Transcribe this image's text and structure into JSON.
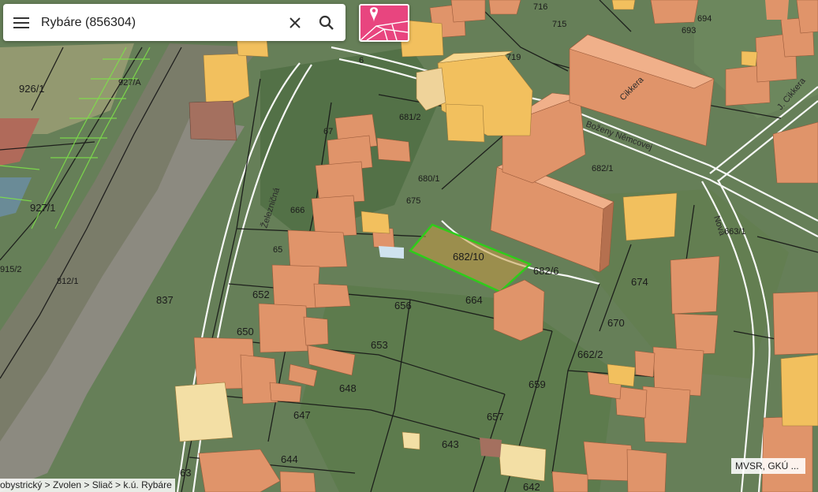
{
  "search": {
    "value": "Rybáre (856304)"
  },
  "icons": {
    "menu": "menu-icon",
    "clear": "close-icon",
    "search": "search-icon",
    "layers": "cadastre-layer-icon"
  },
  "breadcrumb": "obystrický > Zvolen > Sliač > k.ú. Rybáre",
  "attribution": "MVSR, GKÚ ...",
  "colors": {
    "selected_parcel": "#2ecc1a",
    "building": "#e0946a",
    "building_yellow": "#f2c05e",
    "layer_button": "#e8457f",
    "parcel_line": "#1a1a1a"
  },
  "parcels": {
    "p_926_1": "926/1",
    "p_927a": "927/A",
    "p_927_1": "927/1",
    "p_915_2": "915/2",
    "p_812_1": "812/1",
    "p_837": "837",
    "p_716": "716",
    "p_715": "715",
    "p_719": "719",
    "p_6": "6",
    "p_694": "694",
    "p_693": "693",
    "p_681_2": "681/2",
    "p_680_1": "680/1",
    "p_675": "675",
    "p_666": "666",
    "p_682_1": "682/1",
    "p_682_10": "682/10",
    "p_682_6": "682/6",
    "p_674": "674",
    "p_664": "664",
    "p_656": "656",
    "p_652": "652",
    "p_650": "650",
    "p_653": "653",
    "p_670": "670",
    "p_662_2": "662/2",
    "p_659": "659",
    "p_648": "648",
    "p_647": "647",
    "p_657": "657",
    "p_643": "643",
    "p_644": "644",
    "p_63": "63",
    "p_642": "642",
    "p_663_1": "663/1",
    "p_65": "65",
    "p_67": "67"
  },
  "streets": {
    "zeleznicna": "Železničná",
    "nemcovej": "Boženy Němcovej",
    "nova": "Nová",
    "cikkera": "Cikkera",
    "l_cikkera": "J. Cikkera"
  }
}
